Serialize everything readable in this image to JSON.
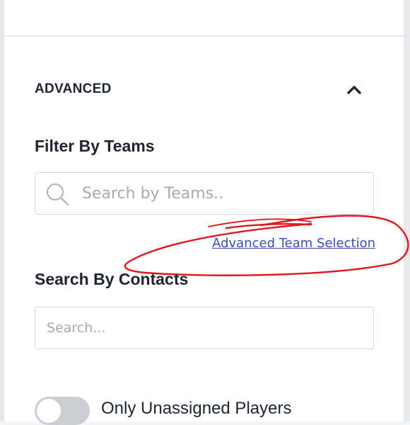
{
  "advanced": {
    "title": "ADVANCED",
    "collapse_icon": "chevron-up-icon"
  },
  "filter_teams": {
    "label": "Filter By Teams",
    "placeholder": "Search by Teams..",
    "icon": "search-icon",
    "advanced_link": "Advanced Team Selection"
  },
  "search_contacts": {
    "label": "Search By Contacts",
    "placeholder": "Search..."
  },
  "unassigned_toggle": {
    "label": "Only Unassigned Players",
    "enabled": false
  },
  "annotation": {
    "color": "#e0161c"
  },
  "colors": {
    "link": "#3c4db4",
    "text": "#1f2530",
    "placeholder": "#a6aab1",
    "toggle_track": "#ccced3"
  }
}
